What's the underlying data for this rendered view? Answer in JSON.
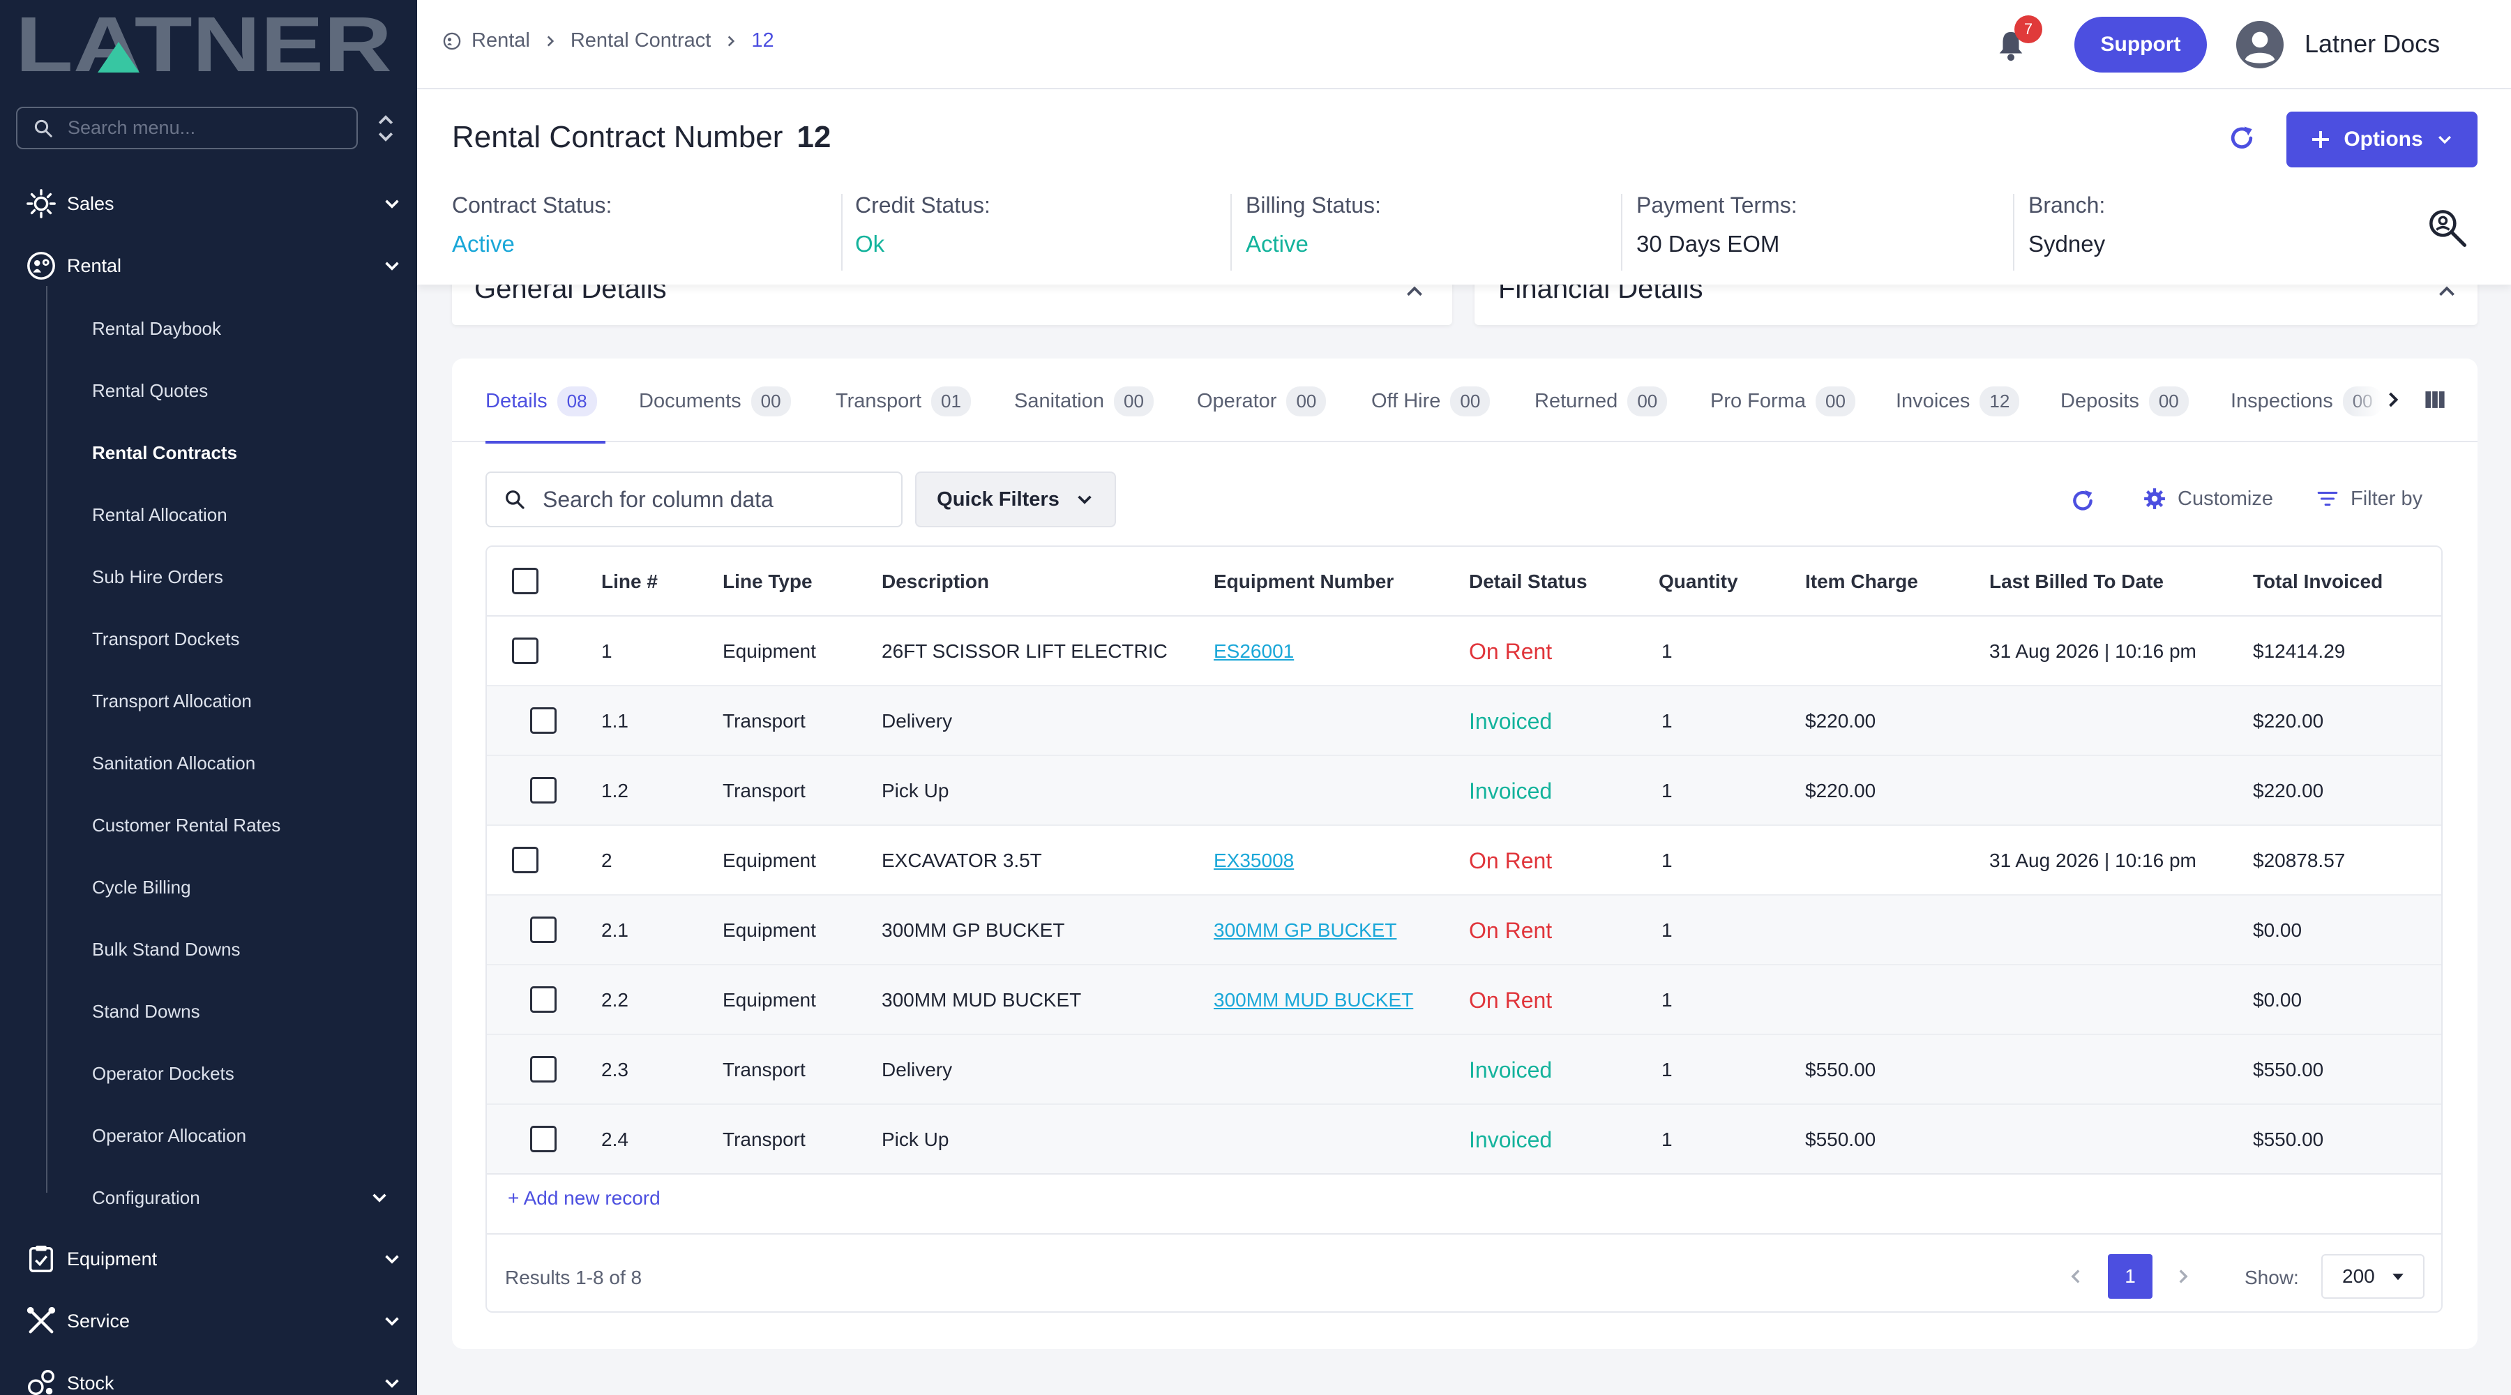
{
  "brand": {
    "logo_text": "LATNER"
  },
  "sidebar": {
    "search_placeholder": "Search menu...",
    "top_items": [
      {
        "label": "Sales",
        "icon": "sales-icon"
      },
      {
        "label": "Rental",
        "icon": "rental-icon"
      },
      {
        "label": "Equipment",
        "icon": "equipment-icon"
      },
      {
        "label": "Service",
        "icon": "service-icon"
      },
      {
        "label": "Stock",
        "icon": "stock-icon"
      }
    ],
    "rental_items": [
      "Rental Daybook",
      "Rental Quotes",
      "Rental Contracts",
      "Rental Allocation",
      "Sub Hire Orders",
      "Transport Dockets",
      "Transport Allocation",
      "Sanitation Allocation",
      "Customer Rental Rates",
      "Cycle Billing",
      "Bulk Stand Downs",
      "Stand Downs",
      "Operator Dockets",
      "Operator Allocation",
      "Configuration"
    ],
    "active_item": "Rental Contracts"
  },
  "header": {
    "breadcrumb": [
      "Rental",
      "Rental Contract",
      "12"
    ],
    "notification_count": "7",
    "support_label": "Support",
    "user_name": "Latner Docs"
  },
  "contract": {
    "title_label": "Rental Contract Number",
    "number": "12",
    "options_label": "Options",
    "stats": [
      {
        "label": "Contract Status:",
        "value": "Active"
      },
      {
        "label": "Credit Status:",
        "value": "Ok"
      },
      {
        "label": "Billing Status:",
        "value": "Active"
      },
      {
        "label": "Payment Terms:",
        "value": "30 Days EOM"
      },
      {
        "label": "Branch:",
        "value": "Sydney"
      }
    ]
  },
  "cards": {
    "general": "General Details",
    "financial": "Financial Details"
  },
  "tabs": [
    {
      "label": "Details",
      "count": "08"
    },
    {
      "label": "Documents",
      "count": "00"
    },
    {
      "label": "Transport",
      "count": "01"
    },
    {
      "label": "Sanitation",
      "count": "00"
    },
    {
      "label": "Operator",
      "count": "00"
    },
    {
      "label": "Off Hire",
      "count": "00"
    },
    {
      "label": "Returned",
      "count": "00"
    },
    {
      "label": "Pro Forma",
      "count": "00"
    },
    {
      "label": "Invoices",
      "count": "12"
    },
    {
      "label": "Deposits",
      "count": "00"
    },
    {
      "label": "Inspections",
      "count": "00"
    }
  ],
  "toolbar": {
    "search_placeholder": "Search for column data",
    "quick_filters": "Quick Filters",
    "customize": "Customize",
    "filter_by": "Filter by"
  },
  "table": {
    "columns": [
      "Line #",
      "Line Type",
      "Description",
      "Equipment Number",
      "Detail Status",
      "Quantity",
      "Item Charge",
      "Last Billed To Date",
      "Total Invoiced"
    ],
    "rows": [
      {
        "line": "1",
        "type": "Equipment",
        "description": "26FT SCISSOR LIFT ELECTRIC",
        "equipment": "ES26001",
        "status": "On Rent",
        "qty": "1",
        "charge": "",
        "last_billed": "31 Aug 2026 | 10:16 pm",
        "total": "$12414.29"
      },
      {
        "line": "1.1",
        "type": "Transport",
        "description": "Delivery",
        "equipment": "",
        "status": "Invoiced",
        "qty": "1",
        "charge": "$220.00",
        "last_billed": "",
        "total": "$220.00"
      },
      {
        "line": "1.2",
        "type": "Transport",
        "description": "Pick Up",
        "equipment": "",
        "status": "Invoiced",
        "qty": "1",
        "charge": "$220.00",
        "last_billed": "",
        "total": "$220.00"
      },
      {
        "line": "2",
        "type": "Equipment",
        "description": "EXCAVATOR 3.5T",
        "equipment": "EX35008",
        "status": "On Rent",
        "qty": "1",
        "charge": "",
        "last_billed": "31 Aug 2026 | 10:16 pm",
        "total": "$20878.57"
      },
      {
        "line": "2.1",
        "type": "Equipment",
        "description": "300MM GP BUCKET",
        "equipment": "300MM GP BUCKET",
        "status": "On Rent",
        "qty": "1",
        "charge": "",
        "last_billed": "",
        "total": "$0.00"
      },
      {
        "line": "2.2",
        "type": "Equipment",
        "description": "300MM MUD BUCKET",
        "equipment": "300MM MUD BUCKET",
        "status": "On Rent",
        "qty": "1",
        "charge": "",
        "last_billed": "",
        "total": "$0.00"
      },
      {
        "line": "2.3",
        "type": "Transport",
        "description": "Delivery",
        "equipment": "",
        "status": "Invoiced",
        "qty": "1",
        "charge": "$550.00",
        "last_billed": "",
        "total": "$550.00"
      },
      {
        "line": "2.4",
        "type": "Transport",
        "description": "Pick Up",
        "equipment": "",
        "status": "Invoiced",
        "qty": "1",
        "charge": "$550.00",
        "last_billed": "",
        "total": "$550.00"
      }
    ],
    "add_record": "+ Add new record",
    "results": "Results 1-8 of 8",
    "current_page": "1",
    "show_label": "Show:",
    "page_size": "200"
  },
  "colors": {
    "sidebar_bg": "#17223a",
    "accent": "#4c4fe0",
    "on_rent": "#e0343a",
    "invoiced": "#14b39c",
    "link": "#1aa7d8"
  }
}
